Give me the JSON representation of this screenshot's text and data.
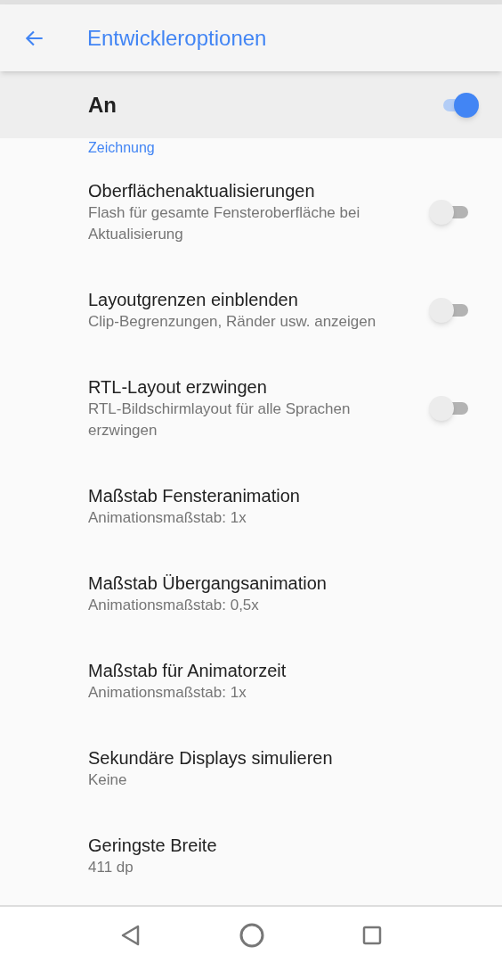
{
  "app_bar": {
    "title": "Entwickleroptionen"
  },
  "master_switch": {
    "label": "An",
    "on": true
  },
  "section_header": "Zeichnung",
  "settings": [
    {
      "kind": "switch",
      "title": "Oberflächenaktualisierungen",
      "summary": "Flash für gesamte Fensteroberfläche bei Aktualisierung",
      "on": false
    },
    {
      "kind": "switch",
      "title": "Layoutgrenzen einblenden",
      "summary": "Clip-Begrenzungen, Ränder usw. anzeigen",
      "on": false
    },
    {
      "kind": "switch",
      "title": "RTL-Layout erzwingen",
      "summary": "RTL-Bildschirmlayout für alle Sprachen erzwingen",
      "on": false
    },
    {
      "kind": "value",
      "title": "Maßstab Fensteranimation",
      "summary": "Animationsmaßstab: 1x"
    },
    {
      "kind": "value",
      "title": "Maßstab Übergangsanimation",
      "summary": "Animationsmaßstab: 0,5x"
    },
    {
      "kind": "value",
      "title": "Maßstab für Animatorzeit",
      "summary": "Animationsmaßstab: 1x"
    },
    {
      "kind": "value",
      "title": "Sekundäre Displays simulieren",
      "summary": "Keine"
    },
    {
      "kind": "value",
      "title": "Geringste Breite",
      "summary": "411 dp"
    }
  ]
}
